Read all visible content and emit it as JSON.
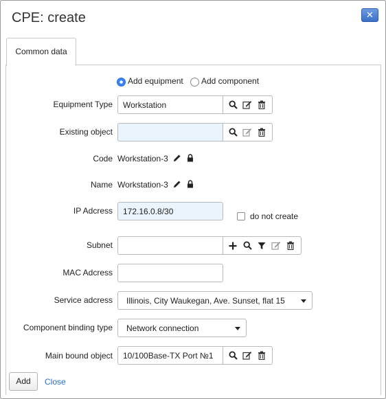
{
  "dialog": {
    "title": "CPE: create",
    "close_icon": "x-close-icon"
  },
  "tabs": [
    {
      "label": "Common data",
      "active": true
    }
  ],
  "mode": {
    "options": [
      "Add equipment",
      "Add component"
    ],
    "selected": "Add equipment"
  },
  "form": {
    "equipment_type": {
      "label": "Equipment Type",
      "value": "Workstation"
    },
    "existing_object": {
      "label": "Existing object",
      "value": ""
    },
    "code": {
      "label": "Code",
      "value": "Workstation-3"
    },
    "name": {
      "label": "Name",
      "value": "Workstation-3"
    },
    "ip_address": {
      "label": "IP Adcress",
      "value": "172.16.0.8/30",
      "checkbox_label": "do not create",
      "checkbox_checked": false
    },
    "subnet": {
      "label": "Subnet",
      "value": ""
    },
    "mac_address": {
      "label": "MAC Adcress",
      "value": ""
    },
    "service_address": {
      "label": "Service adcress",
      "value": "Illinois, City Waukegan, Ave. Sunset, flat 15"
    },
    "binding_type": {
      "label": "Component binding type",
      "value": "Network connection"
    },
    "main_bound_object": {
      "label": "Main bound object",
      "value": "10/100Base-TX Port №1"
    }
  },
  "footer": {
    "add_label": "Add",
    "close_label": "Close"
  },
  "colors": {
    "accent": "#3a82f5",
    "link": "#2a6fc9",
    "input_highlight": "#eaf4fd"
  }
}
